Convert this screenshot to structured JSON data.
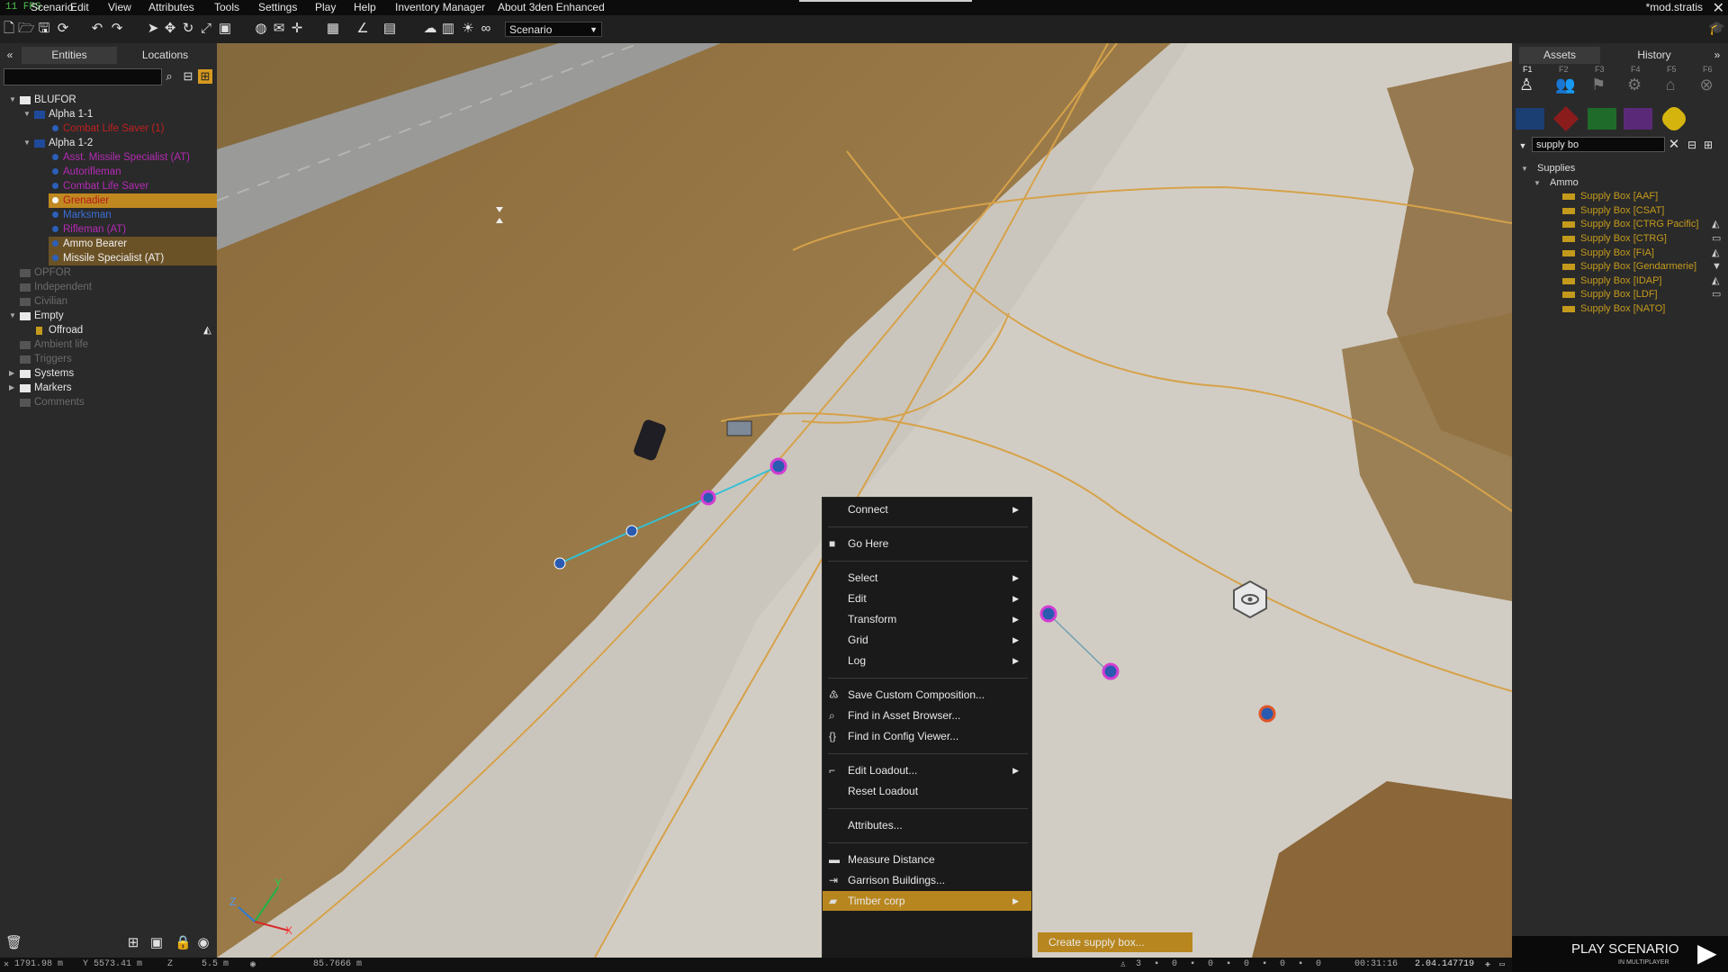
{
  "menubar": {
    "fps": "11 FPS",
    "items": [
      "Scenario",
      "Edit",
      "View",
      "Attributes",
      "Tools",
      "Settings",
      "Play",
      "Help",
      "Inventory Manager",
      "About 3den Enhanced"
    ],
    "mission": "*mod.stratis"
  },
  "toolbar": {
    "scenario_select": "Scenario"
  },
  "left_panel": {
    "collapse": "«",
    "tabs": [
      "Entities",
      "Locations"
    ],
    "search_value": "",
    "tree": [
      {
        "label": "BLUFOR",
        "level": 0,
        "kind": "faction",
        "style": "normal",
        "expanded": true
      },
      {
        "label": "Alpha 1-1",
        "level": 1,
        "kind": "group",
        "style": "normal",
        "expanded": true
      },
      {
        "label": "Combat Life Saver (1)",
        "level": 2,
        "kind": "unit",
        "style": "red"
      },
      {
        "label": "Alpha 1-2",
        "level": 1,
        "kind": "group",
        "style": "normal",
        "expanded": true
      },
      {
        "label": "Asst. Missile Specialist (AT)",
        "level": 2,
        "kind": "unit",
        "style": "magenta"
      },
      {
        "label": "Autorifleman",
        "level": 2,
        "kind": "unit",
        "style": "magenta"
      },
      {
        "label": "Combat Life Saver",
        "level": 2,
        "kind": "unit",
        "style": "magenta"
      },
      {
        "label": "Grenadier",
        "level": 2,
        "kind": "unit",
        "style": "selected"
      },
      {
        "label": "Marksman",
        "level": 2,
        "kind": "unit",
        "style": "blue"
      },
      {
        "label": "Rifleman (AT)",
        "level": 2,
        "kind": "unit",
        "style": "magenta"
      },
      {
        "label": "Ammo Bearer",
        "level": 2,
        "kind": "unit",
        "style": "selected2"
      },
      {
        "label": "Missile Specialist (AT)",
        "level": 2,
        "kind": "unit",
        "style": "selected2"
      },
      {
        "label": "OPFOR",
        "level": 0,
        "kind": "faction",
        "style": "dim"
      },
      {
        "label": "Independent",
        "level": 0,
        "kind": "faction",
        "style": "dim"
      },
      {
        "label": "Civilian",
        "level": 0,
        "kind": "faction",
        "style": "dim"
      },
      {
        "label": "Empty",
        "level": 0,
        "kind": "faction",
        "style": "normal",
        "expanded": true
      },
      {
        "label": "Offroad",
        "level": 1,
        "kind": "vehicle",
        "style": "normal"
      },
      {
        "label": "Ambient life",
        "level": 0,
        "kind": "faction",
        "style": "dim"
      },
      {
        "label": "Triggers",
        "level": 0,
        "kind": "faction",
        "style": "dim"
      },
      {
        "label": "Systems",
        "level": 0,
        "kind": "faction",
        "style": "normal",
        "collapsed": true
      },
      {
        "label": "Markers",
        "level": 0,
        "kind": "faction",
        "style": "normal",
        "collapsed": true
      },
      {
        "label": "Comments",
        "level": 0,
        "kind": "faction",
        "style": "dim"
      }
    ]
  },
  "right_panel": {
    "tabs": [
      "Assets",
      "History"
    ],
    "expand": "»",
    "fkeys": [
      "F1",
      "F2",
      "F3",
      "F4",
      "F5",
      "F6"
    ],
    "side_colors": [
      "#1c3f73",
      "#8a1c1c",
      "#1f6b2a",
      "#5a2a78",
      "#d6b40e"
    ],
    "search_value": "supply bo",
    "tree_root": "Supplies",
    "tree_sub": "Ammo",
    "items": [
      "Supply Box [AAF]",
      "Supply Box [CSAT]",
      "Supply Box [CTRG Pacific]",
      "Supply Box [CTRG]",
      "Supply Box [FIA]",
      "Supply Box [Gendarmerie]",
      "Supply Box [IDAP]",
      "Supply Box [LDF]",
      "Supply Box [NATO]"
    ]
  },
  "context_menu": {
    "items": [
      {
        "label": "Connect",
        "arrow": true,
        "icon": ""
      },
      {
        "sep": true
      },
      {
        "label": "Go Here",
        "arrow": false,
        "icon": "camera-icon"
      },
      {
        "sep": true
      },
      {
        "label": "Select",
        "arrow": true,
        "icon": ""
      },
      {
        "label": "Edit",
        "arrow": true,
        "icon": ""
      },
      {
        "label": "Transform",
        "arrow": true,
        "icon": ""
      },
      {
        "label": "Grid",
        "arrow": true,
        "icon": ""
      },
      {
        "label": "Log",
        "arrow": true,
        "icon": ""
      },
      {
        "sep": true
      },
      {
        "label": "Save Custom Composition...",
        "arrow": false,
        "icon": "composition-icon"
      },
      {
        "label": "Find in Asset Browser...",
        "arrow": false,
        "icon": "search-icon"
      },
      {
        "label": "Find in Config Viewer...",
        "arrow": false,
        "icon": "braces-icon"
      },
      {
        "sep": true
      },
      {
        "label": "Edit Loadout...",
        "arrow": true,
        "icon": "rifle-icon"
      },
      {
        "label": "Reset Loadout",
        "arrow": false,
        "icon": ""
      },
      {
        "sep": true
      },
      {
        "label": "Attributes...",
        "arrow": false,
        "icon": ""
      },
      {
        "sep": true
      },
      {
        "label": "Measure Distance",
        "arrow": false,
        "icon": "ruler-icon"
      },
      {
        "label": "Garrison Buildings...",
        "arrow": false,
        "icon": "enter-icon"
      },
      {
        "label": "Timber corp",
        "arrow": true,
        "icon": "folder-icon",
        "highlight": true
      }
    ],
    "submenu": [
      "Create supply box..."
    ]
  },
  "statusbar": {
    "x": "1791.98 m",
    "y": "5573.41 m",
    "z": "5.5 m",
    "view": "85.7666 m",
    "c1": "3",
    "c2": "0",
    "c3": "0",
    "c4": "0",
    "c5": "0",
    "c6": "0",
    "time": "00:31:16",
    "version": "2.04.147719"
  },
  "play": {
    "label": "PLAY SCENARIO",
    "sub": "IN MULTIPLAYER"
  }
}
